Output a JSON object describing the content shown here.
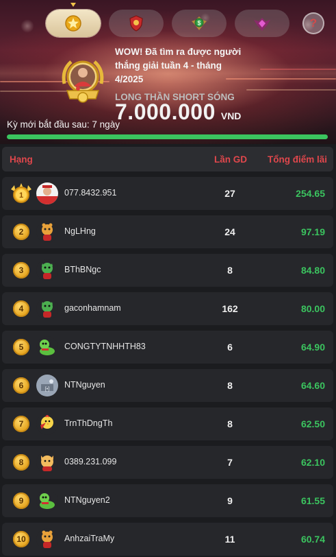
{
  "tabs": [
    {
      "icon": "gold-star-badge-icon",
      "active": true
    },
    {
      "icon": "red-shield-badge-icon",
      "active": false
    },
    {
      "icon": "green-dollar-badge-icon",
      "active": false
    },
    {
      "icon": "purple-gem-badge-icon",
      "active": false
    }
  ],
  "help": {
    "label": "?"
  },
  "winner": {
    "message": "WOW! Đã tìm ra được người thắng giải tuần 4 - tháng 4/2025",
    "name": "LONG THẦN SHORT SÓNG",
    "amount": "7.000.000",
    "unit": "VND"
  },
  "countdown": "Kỳ mới bắt đầu sau: 7 ngày",
  "progress": 1.0,
  "table": {
    "headers": {
      "rank": "Hạng",
      "trades": "Lần GD",
      "score": "Tổng điểm lãi"
    },
    "rows": [
      {
        "rank": "1",
        "name": "077.8432.951",
        "trades": "27",
        "score": "254.65",
        "avatar": "photo-avatar"
      },
      {
        "rank": "2",
        "name": "NgLHng",
        "trades": "24",
        "score": "97.19",
        "avatar": "tiger-mascot-icon"
      },
      {
        "rank": "3",
        "name": "BThBNgc",
        "trades": "8",
        "score": "84.80",
        "avatar": "dragon-mascot-icon"
      },
      {
        "rank": "4",
        "name": "gaconhamnam",
        "trades": "162",
        "score": "80.00",
        "avatar": "dragon-mascot-icon"
      },
      {
        "rank": "5",
        "name": "CONGTYTNHHTH83",
        "trades": "6",
        "score": "64.90",
        "avatar": "snake-mascot-icon"
      },
      {
        "rank": "6",
        "name": "NTNguyen",
        "trades": "8",
        "score": "64.60",
        "avatar": "photo-avatar-2"
      },
      {
        "rank": "7",
        "name": "TrnThDngTh",
        "trades": "8",
        "score": "62.50",
        "avatar": "chick-mascot-icon"
      },
      {
        "rank": "8",
        "name": "0389.231.099",
        "trades": "7",
        "score": "62.10",
        "avatar": "cat-mascot-icon"
      },
      {
        "rank": "9",
        "name": "NTNguyen2",
        "trades": "9",
        "score": "61.55",
        "avatar": "snake-mascot-icon"
      },
      {
        "rank": "10",
        "name": "AnhzaiTraMy",
        "trades": "11",
        "score": "60.74",
        "avatar": "tiger-mascot-icon"
      }
    ]
  },
  "colors": {
    "accent_red": "#e0474c",
    "positive_green": "#3bc45f",
    "gold": "#f1c24a"
  }
}
